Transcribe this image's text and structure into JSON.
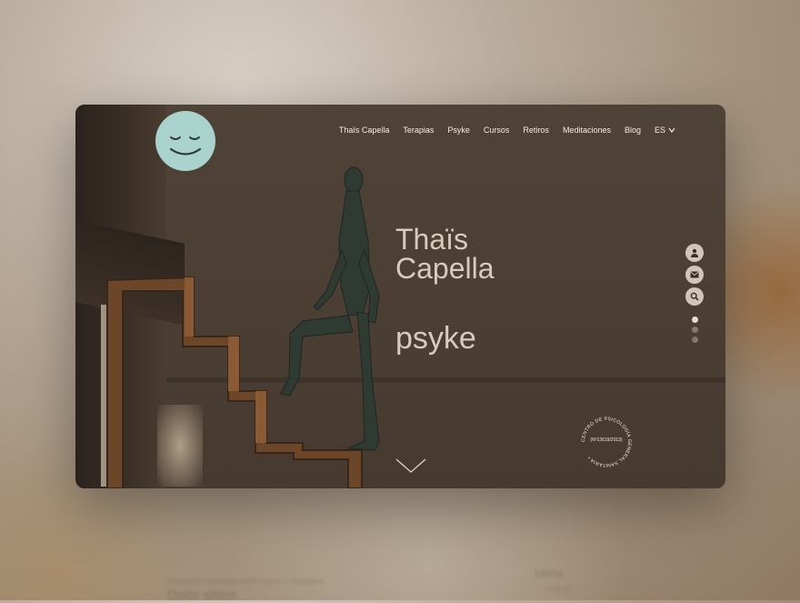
{
  "nav": {
    "items": [
      "Thaïs Capella",
      "Terapias",
      "Psyke",
      "Cursos",
      "Retiros",
      "Meditaciones",
      "Blog"
    ],
    "language": "ES"
  },
  "hero": {
    "title_line1": "Thaïs",
    "title_line2": "Capella",
    "subtitle": "psyke"
  },
  "seal": {
    "ring_text": "CENTRO DE PSICOLOGÍA GENERAL SANITARIA •",
    "center_text": "(Nº13619/2013)"
  },
  "side_icons": [
    "user-icon",
    "mail-icon",
    "search-icon"
  ],
  "pager": {
    "count": 3,
    "active": 0
  },
  "background_page": {
    "post_meta": "Posted in Uncategorized   Leave a comment",
    "post_title": "Dolor sitam",
    "meta_title": "Meta",
    "meta_item": "Log in"
  },
  "colors": {
    "logo": "#a9d3cc",
    "hero_text": "#d8cbbd",
    "nav_text": "#f3ece3",
    "icon_bg": "#d2c5b7"
  }
}
